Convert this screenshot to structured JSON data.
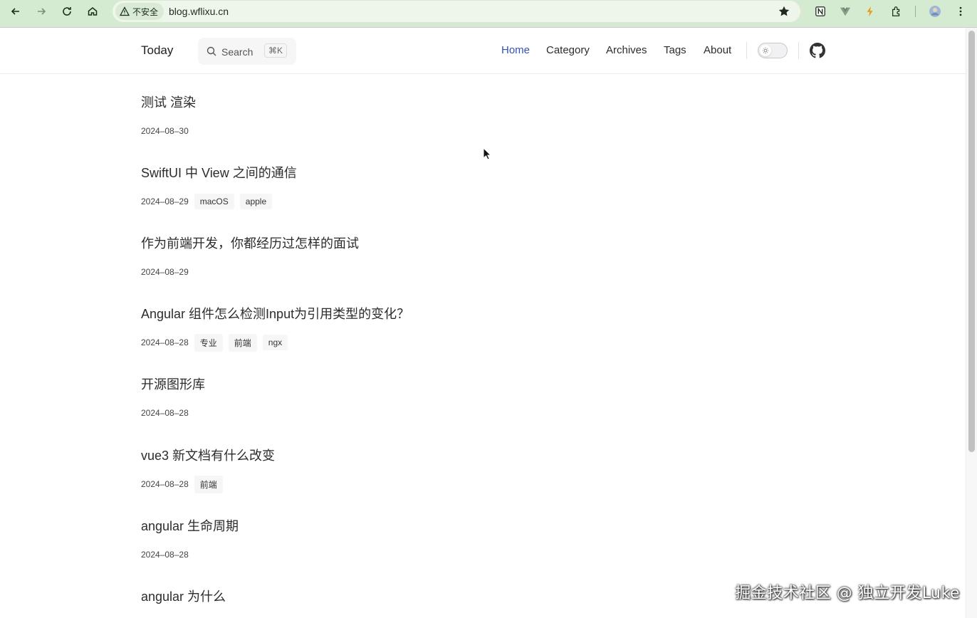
{
  "browser": {
    "security_label": "不安全",
    "url": "blog.wflixu.cn"
  },
  "header": {
    "brand": "Today",
    "search_label": "Search",
    "search_shortcut": "⌘K",
    "nav": [
      {
        "label": "Home",
        "active": true
      },
      {
        "label": "Category",
        "active": false
      },
      {
        "label": "Archives",
        "active": false
      },
      {
        "label": "Tags",
        "active": false
      },
      {
        "label": "About",
        "active": false
      }
    ]
  },
  "posts": [
    {
      "title": "测试 渲染",
      "date": "2024–08–30",
      "tags": []
    },
    {
      "title": "SwiftUI 中 View 之间的通信",
      "date": "2024–08–29",
      "tags": [
        "macOS",
        "apple"
      ]
    },
    {
      "title": "作为前端开发，你都经历过怎样的面试",
      "date": "2024–08–29",
      "tags": []
    },
    {
      "title": "Angular 组件怎么检测Input为引用类型的变化？",
      "date": "2024–08–28",
      "tags": [
        "专业",
        "前端",
        "ngx"
      ]
    },
    {
      "title": "开源图形库",
      "date": "2024–08–28",
      "tags": []
    },
    {
      "title": "vue3 新文档有什么改变",
      "date": "2024–08–28",
      "tags": [
        "前端"
      ]
    },
    {
      "title": "angular 生命周期",
      "date": "2024–08–28",
      "tags": []
    },
    {
      "title": "angular 为什么",
      "date": "",
      "tags": []
    }
  ],
  "watermark": "掘金技术社区 @ 独立开发Luke",
  "colors": {
    "browser_bar": "#d4ead1",
    "nav_active": "#3451b2",
    "tag_bg": "#f6f6f7"
  }
}
